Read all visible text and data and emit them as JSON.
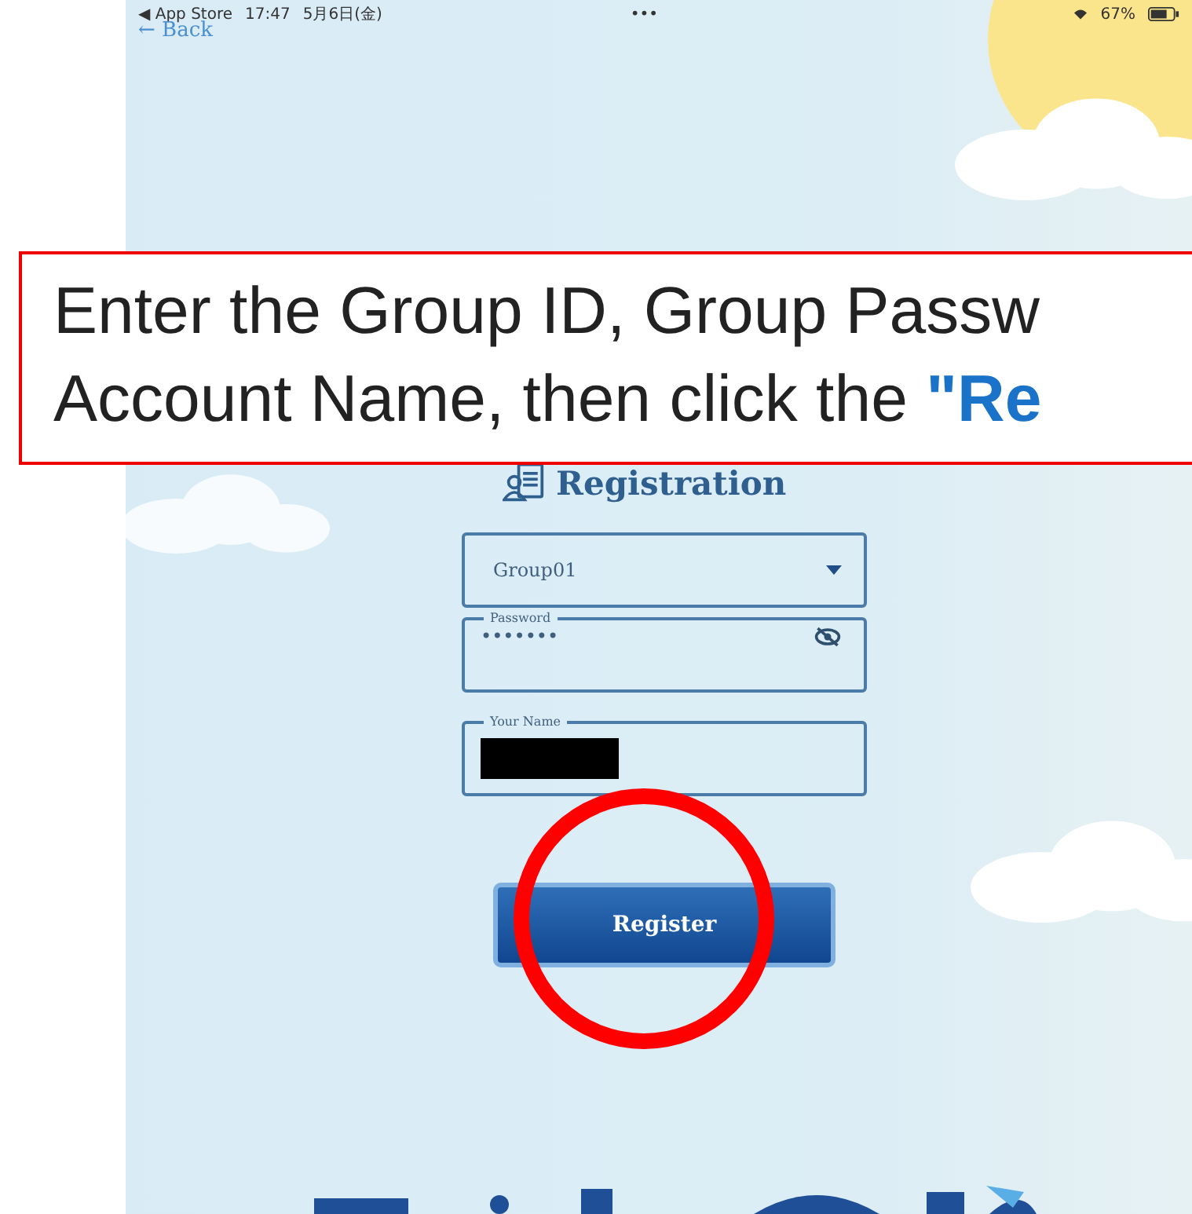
{
  "status_bar": {
    "back_app": "◀ App Store",
    "time": "17:47",
    "date": "5月6日(金)",
    "dots": "•••",
    "battery": "67%"
  },
  "back_link": {
    "arrow": "←",
    "label": "Back"
  },
  "callout": {
    "lines": [
      "Enter the Group ID, Group Passw",
      "Account Name, then click the **\"Re**"
    ]
  },
  "title": "Registration",
  "group_select": {
    "value": "Group01"
  },
  "password": {
    "label": "Password",
    "value": "•••••••",
    "visible": false
  },
  "name_field": {
    "label": "Your Name",
    "redacted": true
  },
  "register_button": {
    "label": "Register",
    "highlighted": true
  }
}
